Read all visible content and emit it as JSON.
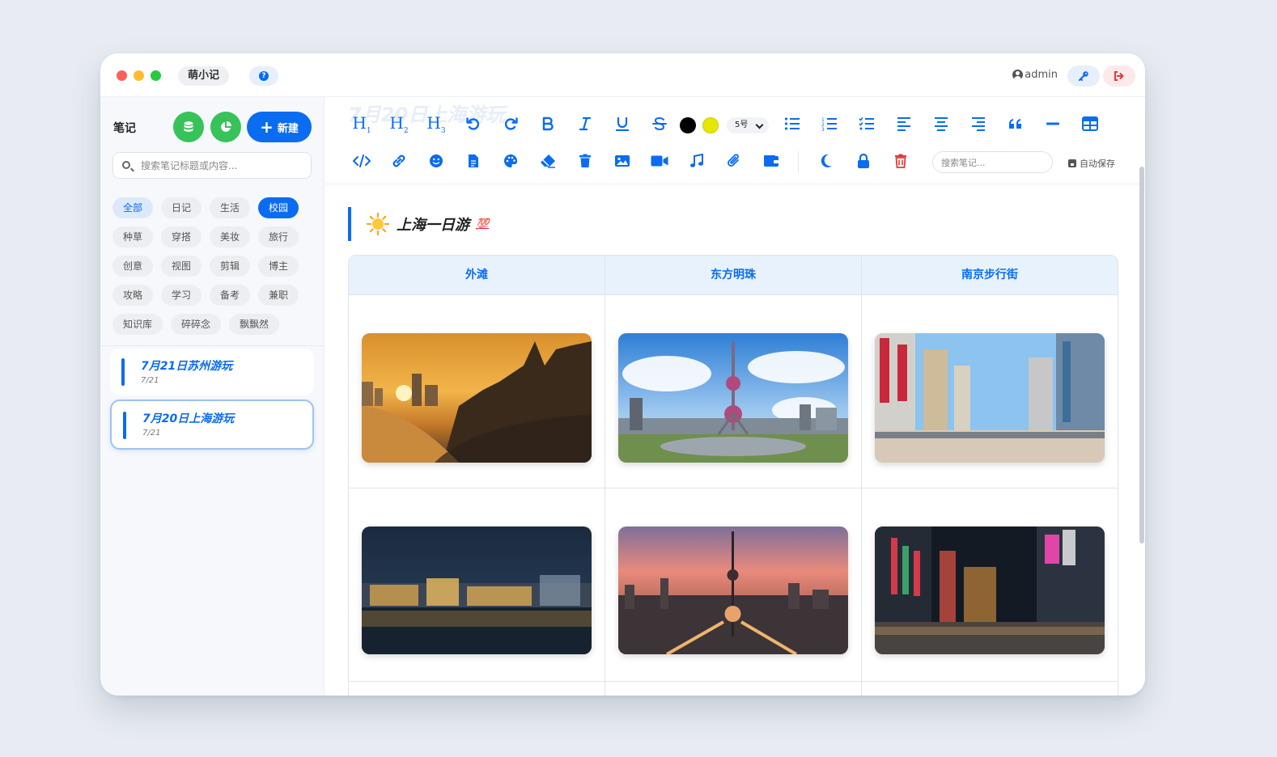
{
  "app": {
    "name": "萌小记",
    "help_label": "?",
    "user": "admin"
  },
  "sidebar": {
    "title": "笔记",
    "new_label": "新建",
    "search_placeholder": "搜索笔记标题或内容...",
    "tags": [
      {
        "label": "全部",
        "state": "all"
      },
      {
        "label": "日记",
        "state": ""
      },
      {
        "label": "生活",
        "state": ""
      },
      {
        "label": "校园",
        "state": "active"
      },
      {
        "label": "种草",
        "state": ""
      },
      {
        "label": "穿搭",
        "state": ""
      },
      {
        "label": "美妆",
        "state": ""
      },
      {
        "label": "旅行",
        "state": ""
      },
      {
        "label": "创意",
        "state": ""
      },
      {
        "label": "视图",
        "state": ""
      },
      {
        "label": "剪辑",
        "state": ""
      },
      {
        "label": "博主",
        "state": ""
      },
      {
        "label": "攻略",
        "state": ""
      },
      {
        "label": "学习",
        "state": ""
      },
      {
        "label": "备考",
        "state": ""
      },
      {
        "label": "兼职",
        "state": ""
      },
      {
        "label": "知识库",
        "state": ""
      },
      {
        "label": "碎碎念",
        "state": ""
      },
      {
        "label": "飘飘然",
        "state": ""
      }
    ],
    "notes": [
      {
        "title": "7月21日苏州游玩",
        "date": "7/21"
      },
      {
        "title": "7月20日上海游玩",
        "date": "7/21"
      }
    ]
  },
  "editor": {
    "ghost_title": "7月20日上海游玩",
    "font_size": "5号",
    "text_color": "#000000",
    "highlight_color": "#e6e600",
    "search_placeholder": "搜索笔记...",
    "autosave_label": "自动保存",
    "heading_text": "上海一日游",
    "heading_badge": "💯",
    "table_headers": [
      "外滩",
      "东方明珠",
      "南京步行街"
    ],
    "toolbar_row1": [
      "heading-1",
      "heading-2",
      "heading-3",
      "undo",
      "redo",
      "bold",
      "italic",
      "underline",
      "strikethrough",
      "text-color",
      "highlight-color",
      "font-size",
      "bullet-list",
      "ordered-list",
      "task-list",
      "align-left",
      "align-center",
      "align-right",
      "quote",
      "horizontal-rule",
      "table"
    ],
    "toolbar_row2": [
      "code",
      "link",
      "emoji",
      "file",
      "palette",
      "eraser",
      "delete",
      "image",
      "video",
      "music",
      "attachment",
      "wallet",
      "dark-mode",
      "lock",
      "delete-note"
    ],
    "photos": [
      [
        "bund-sunset",
        "oriental-pearl-day",
        "nanjing-road-day"
      ],
      [
        "bund-night",
        "oriental-pearl-sunset",
        "nanjing-road-night"
      ]
    ]
  },
  "colors": {
    "accent": "#0a6cf0",
    "green": "#37c25a",
    "danger": "#e53935"
  }
}
